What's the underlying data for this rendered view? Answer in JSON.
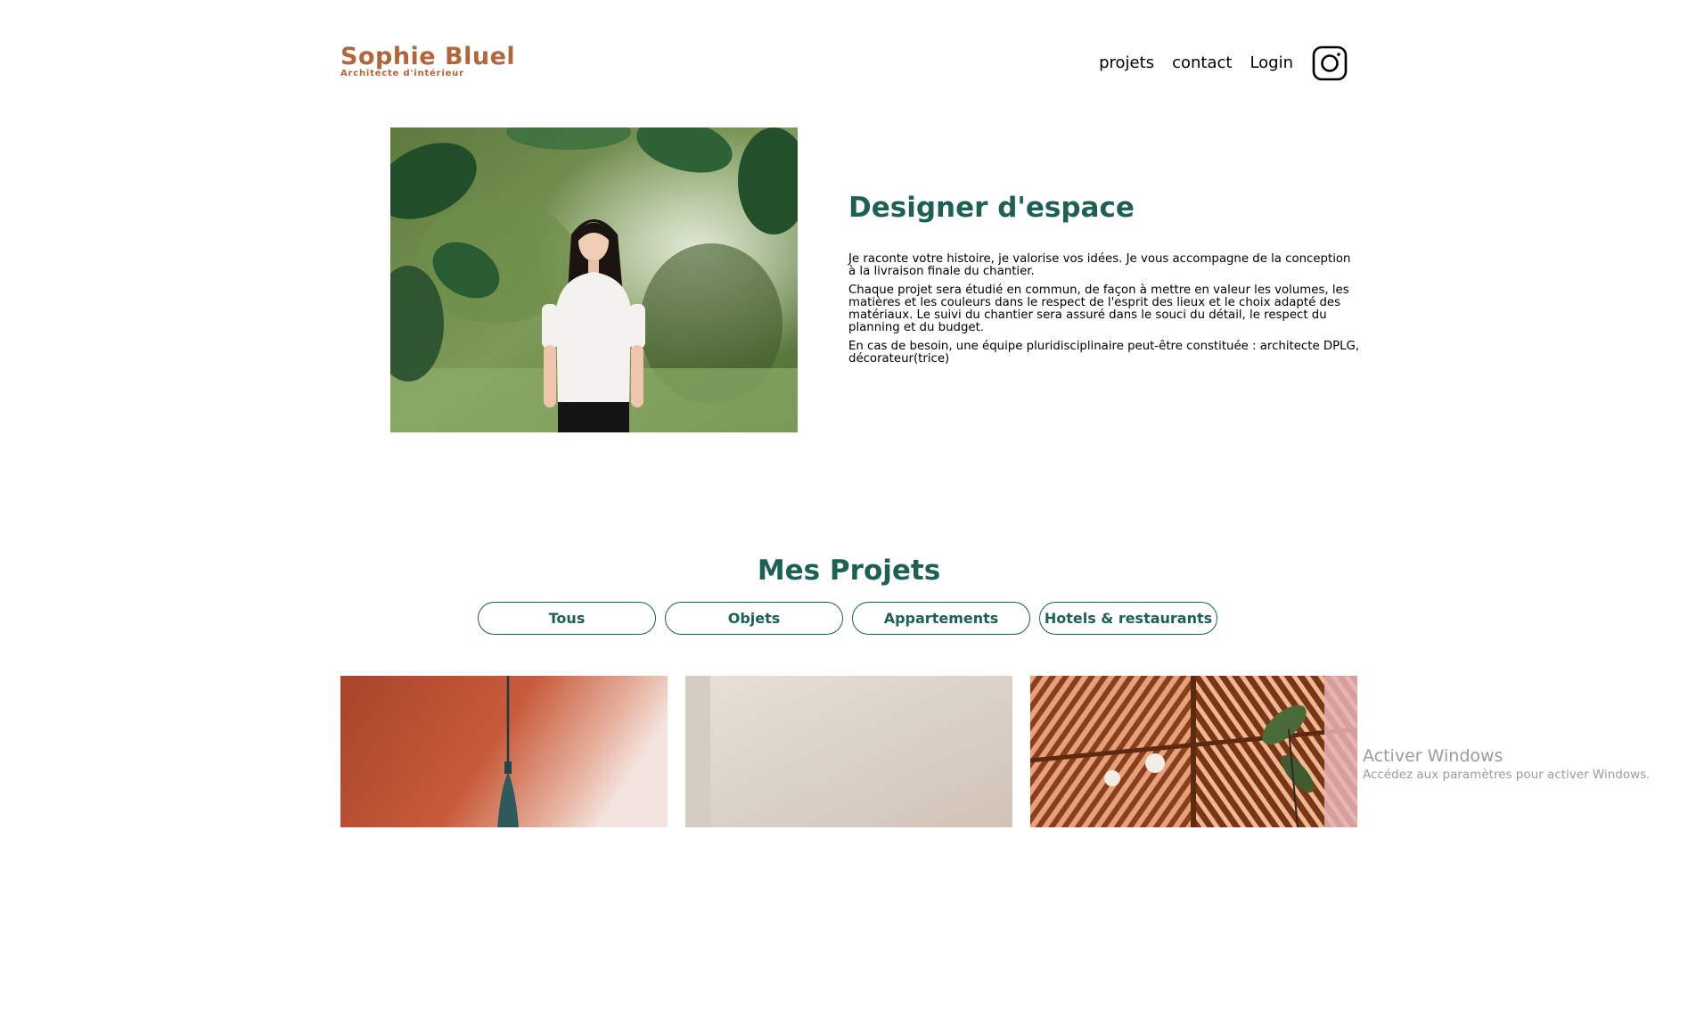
{
  "header": {
    "logo_title": "Sophie Bluel",
    "logo_subtitle": "Architecte d'intérieur",
    "nav": {
      "projets": "projets",
      "contact": "contact",
      "login": "Login"
    },
    "social_icon": "instagram-icon"
  },
  "introduction": {
    "title": "Designer d'espace",
    "paragraphs": [
      "Je raconte votre histoire, je valorise vos idées. Je vous accompagne de la conception à la livraison finale du chantier.",
      "Chaque projet sera étudié en commun, de façon à mettre en valeur les volumes, les matières et les couleurs dans le respect de l'esprit des lieux et le choix adapté des matériaux. Le suivi du chantier sera assuré dans le souci du détail, le respect du planning et du budget.",
      "En cas de besoin, une équipe pluridisciplinaire peut-être constituée : architecte DPLG, décorateur(trice)"
    ]
  },
  "portfolio": {
    "title": "Mes Projets",
    "filters": [
      "Tous",
      "Objets",
      "Appartements",
      "Hotels & restaurants"
    ]
  },
  "watermark": {
    "title": "Activer Windows",
    "subtitle": "Accédez aux paramètres pour activer Windows."
  },
  "colors": {
    "brand": "#B1663C",
    "accent": "#1D6154"
  }
}
